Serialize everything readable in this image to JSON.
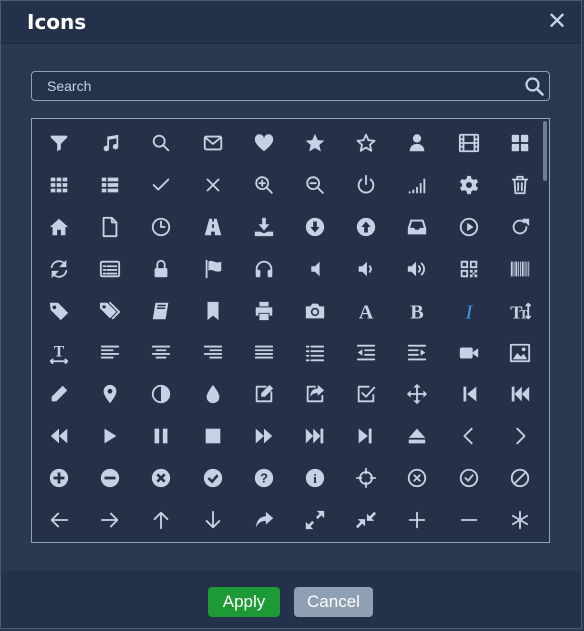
{
  "dialog": {
    "title": "Icons",
    "close_label": "✕"
  },
  "search": {
    "placeholder": "Search",
    "value": ""
  },
  "footer": {
    "apply_label": "Apply",
    "cancel_label": "Cancel"
  },
  "colors": {
    "background": "#2a3950",
    "titlebar": "#23314a",
    "icon": "#c6d1e3",
    "italic_icon": "#3a9ae8",
    "apply": "#1d9a35",
    "cancel": "#8f9fb4"
  },
  "icons": [
    [
      "filter-icon",
      "music-icon",
      "search-icon",
      "envelope-icon",
      "heart-icon",
      "star-icon",
      "star-empty-icon",
      "user-icon",
      "film-icon",
      "th-large-icon"
    ],
    [
      "th-icon",
      "th-list-icon",
      "ok-icon",
      "remove-icon",
      "zoom-in-icon",
      "zoom-out-icon",
      "off-icon",
      "signal-icon",
      "cog-icon",
      "trash-icon"
    ],
    [
      "home-icon",
      "file-icon",
      "time-icon",
      "road-icon",
      "download-alt-icon",
      "download-icon",
      "upload-icon",
      "inbox-icon",
      "play-circle-icon",
      "repeat-icon"
    ],
    [
      "refresh-icon",
      "list-alt-icon",
      "lock-icon",
      "flag-icon",
      "headphones-icon",
      "volume-off-icon",
      "volume-down-icon",
      "volume-up-icon",
      "qrcode-icon",
      "barcode-icon"
    ],
    [
      "tag-icon",
      "tags-icon",
      "book-icon",
      "bookmark-icon",
      "print-icon",
      "camera-icon",
      "font-icon",
      "bold-icon",
      "italic-icon",
      "text-height-icon"
    ],
    [
      "text-width-icon",
      "align-left-icon",
      "align-center-icon",
      "align-right-icon",
      "align-justify-icon",
      "list-icon",
      "indent-left-icon",
      "indent-right-icon",
      "facetime-video-icon",
      "picture-icon"
    ],
    [
      "pencil-icon",
      "map-marker-icon",
      "adjust-icon",
      "tint-icon",
      "edit-icon",
      "share-icon",
      "check-icon",
      "move-icon",
      "step-backward-icon",
      "fast-backward-icon"
    ],
    [
      "backward-icon",
      "play-icon",
      "pause-icon",
      "stop-icon",
      "forward-icon",
      "fast-forward-icon",
      "step-forward-icon",
      "eject-icon",
      "chevron-left-icon",
      "chevron-right-icon"
    ],
    [
      "plus-sign-icon",
      "minus-sign-icon",
      "remove-sign-icon",
      "ok-sign-icon",
      "question-sign-icon",
      "info-sign-icon",
      "screenshot-icon",
      "remove-circle-icon",
      "ok-circle-icon",
      "ban-circle-icon"
    ],
    [
      "arrow-left-icon",
      "arrow-right-icon",
      "arrow-up-icon",
      "arrow-down-icon",
      "share-alt-icon",
      "resize-full-icon",
      "resize-small-icon",
      "plus-icon",
      "minus-icon",
      "asterisk-icon"
    ]
  ]
}
